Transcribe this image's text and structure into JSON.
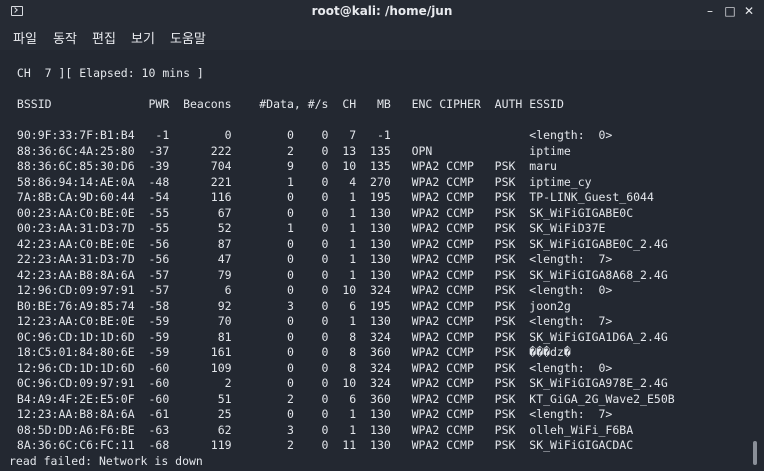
{
  "window": {
    "title": "root@kali: /home/jun",
    "minimize": "–",
    "maximize": "□",
    "close": "✕"
  },
  "menu": [
    "파일",
    "동작",
    "편집",
    "보기",
    "도움말"
  ],
  "terminal": {
    "lines": [
      " CH  7 ][ Elapsed: 10 mins ]",
      "",
      " BSSID              PWR  Beacons    #Data, #/s  CH   MB   ENC CIPHER  AUTH ESSID",
      "",
      " 90:9F:33:7F:B1:B4   -1        0        0    0   7   -1                    <length:  0>",
      " 88:36:6C:4A:25:80  -37      222        2    0  13  135   OPN              iptime",
      " 88:36:6C:85:30:D6  -39      704        9    0  10  135   WPA2 CCMP   PSK  maru",
      " 58:86:94:14:AE:0A  -48      221        1    0   4  270   WPA2 CCMP   PSK  iptime_cy",
      " 7A:8B:CA:9D:60:44  -54      116        0    0   1  195   WPA2 CCMP   PSK  TP-LINK_Guest_6044",
      " 00:23:AA:C0:BE:0E  -55       67        0    0   1  130   WPA2 CCMP   PSK  SK_WiFiGIGABE0C",
      " 00:23:AA:31:D3:7D  -55       52        1    0   1  130   WPA2 CCMP   PSK  SK_WiFiD37E",
      " 42:23:AA:C0:BE:0E  -56       87        0    0   1  130   WPA2 CCMP   PSK  SK_WiFiGIGABE0C_2.4G",
      " 22:23:AA:31:D3:7D  -56       47        0    0   1  130   WPA2 CCMP   PSK  <length:  7>",
      " 42:23:AA:B8:8A:6A  -57       79        0    0   1  130   WPA2 CCMP   PSK  SK_WiFiGIGA8A68_2.4G",
      " 12:96:CD:09:97:91  -57        6        0    0  10  324   WPA2 CCMP   PSK  <length:  0>",
      " B0:BE:76:A9:85:74  -58       92        3    0   6  195   WPA2 CCMP   PSK  joon2g",
      " 12:23:AA:C0:BE:0E  -59       70        0    0   1  130   WPA2 CCMP   PSK  <length:  7>",
      " 0C:96:CD:1D:1D:6D  -59       81        0    0   8  324   WPA2 CCMP   PSK  SK_WiFiGIGA1D6A_2.4G",
      " 18:C5:01:84:80:6E  -59      161        0    0   8  360   WPA2 CCMP   PSK  ���dz�",
      " 12:96:CD:1D:1D:6D  -60      109        0    0   8  324   WPA2 CCMP   PSK  <length:  0>",
      " 0C:96:CD:09:97:91  -60        2        0    0  10  324   WPA2 CCMP   PSK  SK_WiFiGIGA978E_2.4G",
      " B4:A9:4F:2E:E5:0F  -60       51        2    0   6  360   WPA2 CCMP   PSK  KT_GiGA_2G_Wave2_E50B",
      " 12:23:AA:B8:8A:6A  -61       25        0    0   1  130   WPA2 CCMP   PSK  <length:  7>",
      " 08:5D:DD:A6:F6:BE  -63       62        3    0   1  130   WPA2 CCMP   PSK  olleh_WiFi_F6BA",
      " 8A:36:6C:C6:FC:11  -68      119        2    0  11  130   WPA2 CCMP   PSK  SK_WiFiGIGACDAC",
      "read failed: Network is down"
    ]
  }
}
